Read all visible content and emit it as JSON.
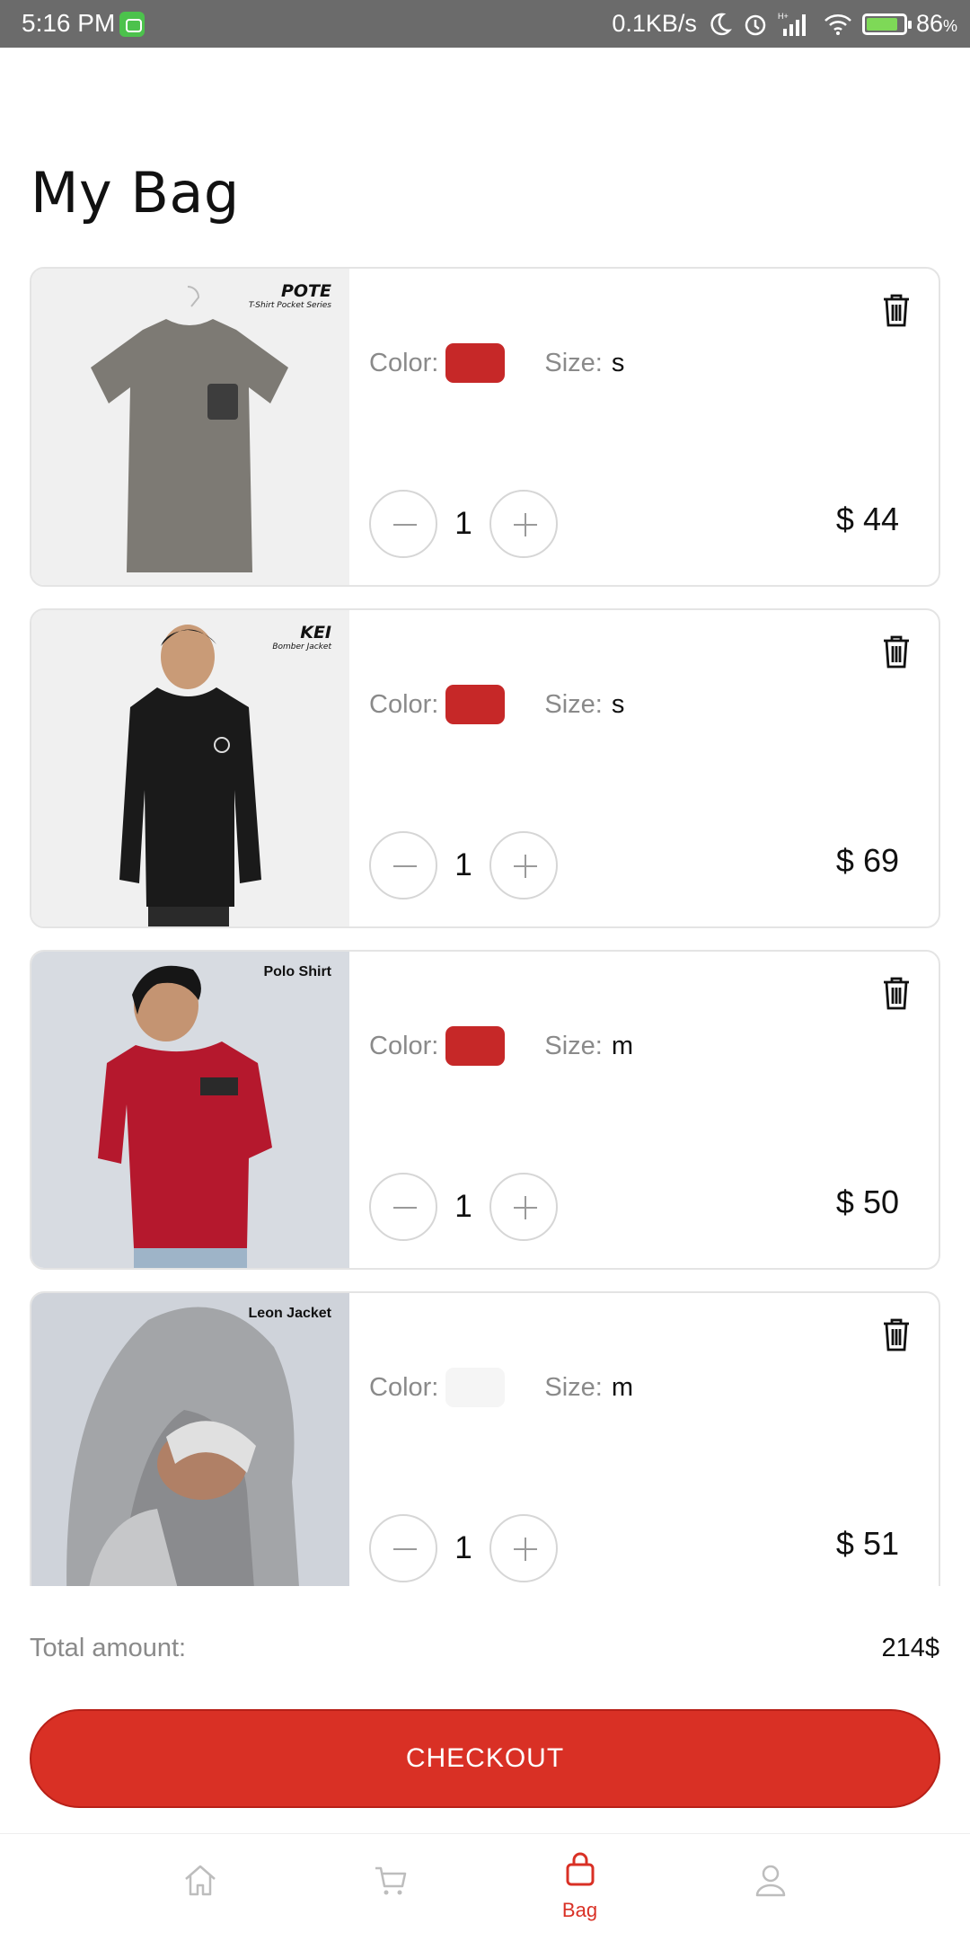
{
  "status_bar": {
    "time": "5:16 PM",
    "network_speed": "0.1KB/s",
    "battery_percent": "86",
    "battery_unit": "%"
  },
  "page": {
    "title": "My Bag"
  },
  "items": [
    {
      "brand": "POTE",
      "brand_sub": "T-Shirt Pocket Series",
      "color_label": "Color:",
      "color": "#c62828",
      "size_label": "Size:",
      "size": "s",
      "quantity": "1",
      "price": "$ 44"
    },
    {
      "brand": "KEI",
      "brand_sub": "Bomber Jacket",
      "color_label": "Color:",
      "color": "#c62828",
      "size_label": "Size:",
      "size": "s",
      "quantity": "1",
      "price": "$ 69"
    },
    {
      "brand": "Polo Shirt",
      "color_label": "Color:",
      "color": "#c62828",
      "size_label": "Size:",
      "size": "m",
      "quantity": "1",
      "price": "$ 50"
    },
    {
      "brand": "Leon Jacket",
      "color_label": "Color:",
      "color": "#f5f5f5",
      "size_label": "Size:",
      "size": "m",
      "quantity": "1",
      "price": "$ 51"
    }
  ],
  "summary": {
    "total_label": "Total amount:",
    "total_value": "214$",
    "checkout_label": "CHECKOUT"
  },
  "bottom_nav": {
    "items": [
      {
        "icon": "home-icon",
        "label": ""
      },
      {
        "icon": "cart-icon",
        "label": ""
      },
      {
        "icon": "bag-icon",
        "label": "Bag",
        "active": true
      },
      {
        "icon": "profile-icon",
        "label": ""
      }
    ],
    "accent_color": "#d93025"
  },
  "colors": {
    "accent": "#d93025",
    "status_bar": "#6b6b6b"
  }
}
